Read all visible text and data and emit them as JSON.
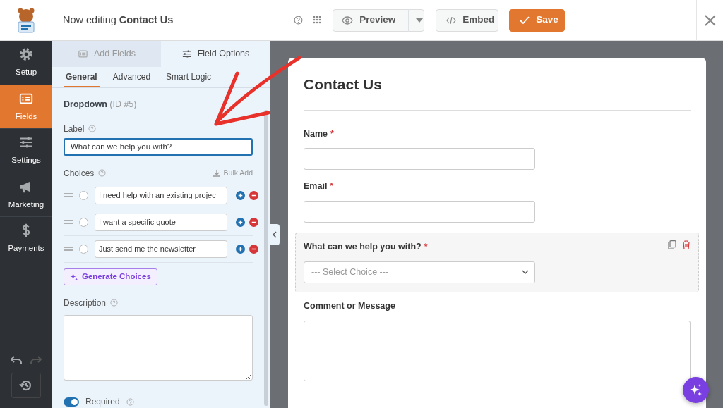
{
  "header": {
    "title_prefix": "Now editing",
    "title": "Contact Us",
    "preview": "Preview",
    "embed": "Embed",
    "save": "Save"
  },
  "sidebar": {
    "items": [
      {
        "label": "Setup",
        "selected": false
      },
      {
        "label": "Fields",
        "selected": true
      },
      {
        "label": "Settings",
        "selected": false
      },
      {
        "label": "Marketing",
        "selected": false
      },
      {
        "label": "Payments",
        "selected": false
      }
    ]
  },
  "panel": {
    "tabs": [
      {
        "label": "Add Fields",
        "selected": false
      },
      {
        "label": "Field Options",
        "selected": true
      }
    ],
    "subtabs": [
      {
        "label": "General",
        "selected": true
      },
      {
        "label": "Advanced",
        "selected": false
      },
      {
        "label": "Smart Logic",
        "selected": false
      }
    ],
    "field_type": "Dropdown",
    "field_id": "(ID #5)",
    "label_field": {
      "label": "Label",
      "value": "What can we help you with?"
    },
    "choices": {
      "label": "Choices",
      "bulk_add": "Bulk Add",
      "items": [
        {
          "value": "I need help with an existing projec",
          "selected": false
        },
        {
          "value": "I want a specific quote",
          "selected": false
        },
        {
          "value": "Just send me the newsletter",
          "selected": false
        }
      ]
    },
    "generate_button": "Generate Choices",
    "description": {
      "label": "Description"
    },
    "required": {
      "label": "Required",
      "on": true
    }
  },
  "form": {
    "title": "Contact Us",
    "fields": [
      {
        "kind": "text",
        "label": "Name",
        "required_mark": "*",
        "selected": false
      },
      {
        "kind": "text",
        "label": "Email",
        "required_mark": "*",
        "selected": false
      },
      {
        "kind": "select",
        "label": "What can we help you with?",
        "required_mark": "*",
        "selected": true,
        "placeholder": "--- Select Choice ---"
      },
      {
        "kind": "textarea",
        "label": "Comment or Message",
        "selected": false
      }
    ]
  }
}
